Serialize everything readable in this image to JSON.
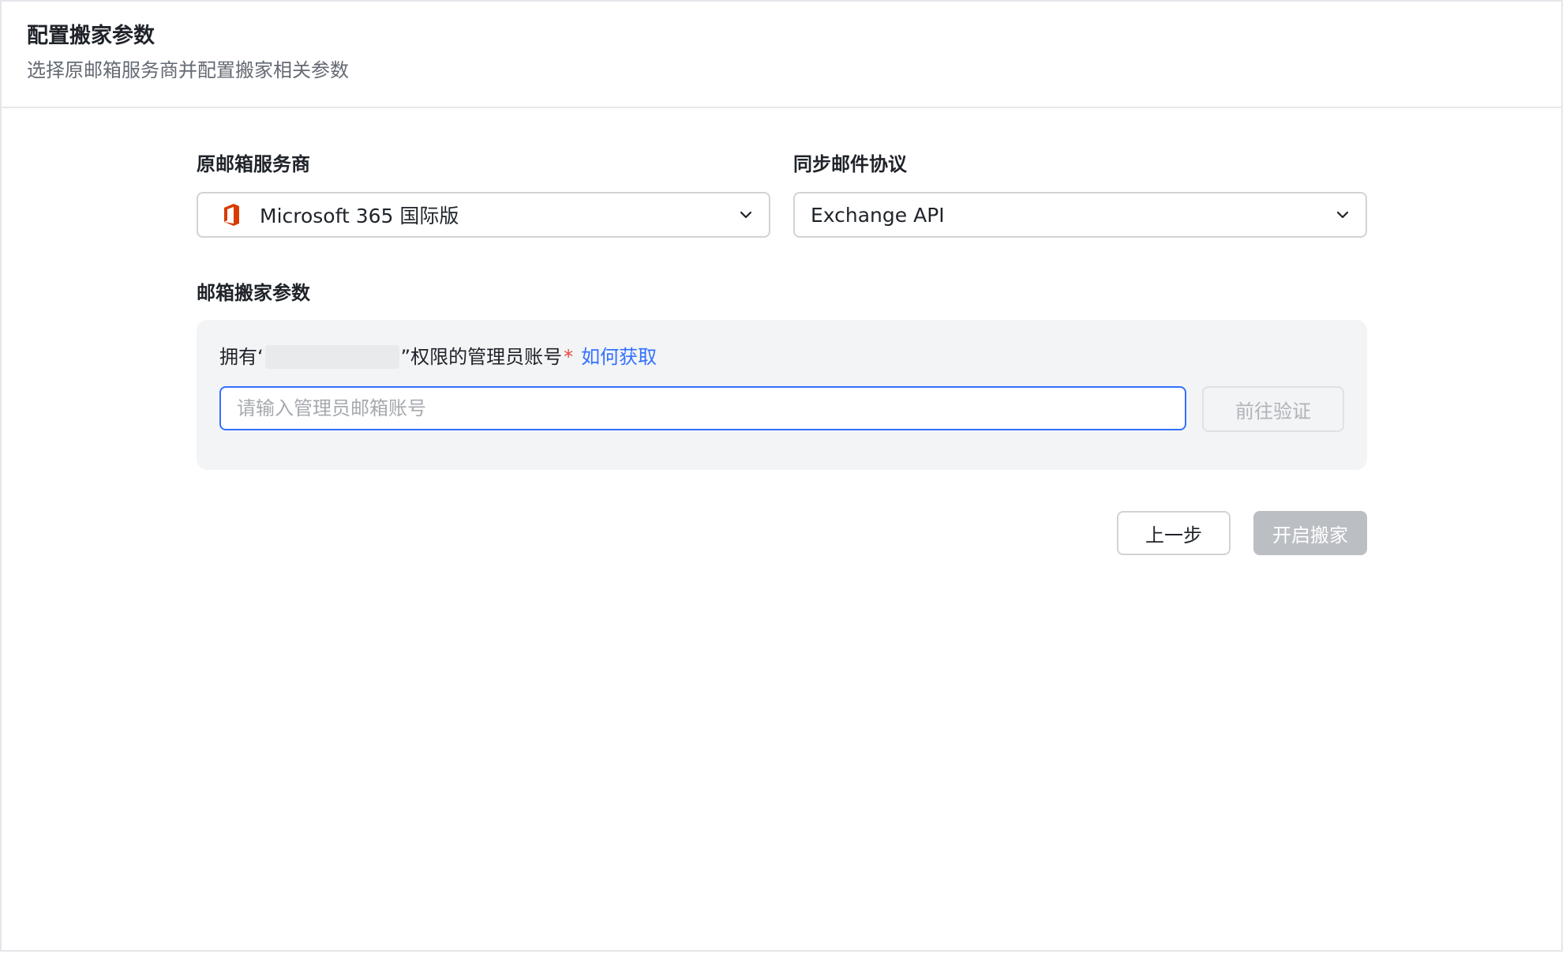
{
  "header": {
    "title": "配置搬家参数",
    "subtitle": "选择原邮箱服务商并配置搬家相关参数"
  },
  "provider": {
    "label": "原邮箱服务商",
    "selected": "Microsoft 365 国际版",
    "icon": "microsoft-office-icon",
    "icon_color": "#d83b01"
  },
  "protocol": {
    "label": "同步邮件协议",
    "selected": "Exchange API"
  },
  "migration_params": {
    "section_label": "邮箱搬家参数",
    "admin_label_prefix": "拥有‘",
    "admin_label_suffix": "”权限的管理员账号",
    "required_mark": "*",
    "help_link": "如何获取",
    "input_placeholder": "请输入管理员邮箱账号",
    "input_value": "",
    "verify_button": "前往验证"
  },
  "footer": {
    "prev_button": "上一步",
    "start_button": "开启搬家"
  },
  "colors": {
    "accent": "#3370ff",
    "required": "#e5483d",
    "disabled_button": "#bbbfc4"
  }
}
